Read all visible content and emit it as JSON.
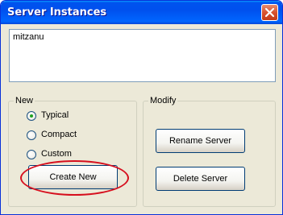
{
  "window": {
    "title": "Server Instances",
    "close_icon": "close-icon"
  },
  "server_list": {
    "items": [
      "mitzanu"
    ]
  },
  "new_group": {
    "legend": "New",
    "options": [
      {
        "label": "Typical",
        "selected": true
      },
      {
        "label": "Compact",
        "selected": false
      },
      {
        "label": "Custom",
        "selected": false
      }
    ],
    "create_button": "Create New"
  },
  "modify_group": {
    "legend": "Modify",
    "rename_button": "Rename Server",
    "delete_button": "Delete Server"
  },
  "colors": {
    "titlebar": "#0054e3",
    "highlight": "#d60f1e",
    "dialog_bg": "#ece9d8"
  }
}
